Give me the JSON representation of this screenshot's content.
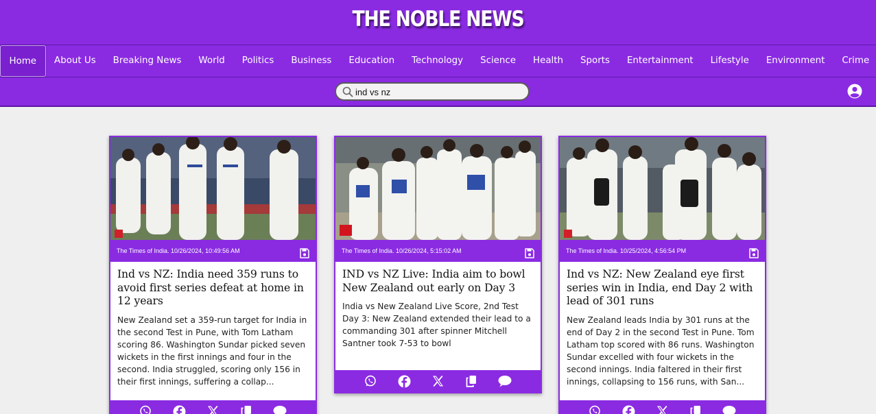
{
  "site": {
    "title": "THE NOBLE NEWS"
  },
  "nav": {
    "items": [
      {
        "label": "Home",
        "active": true
      },
      {
        "label": "About Us"
      },
      {
        "label": "Breaking News"
      },
      {
        "label": "World"
      },
      {
        "label": "Politics"
      },
      {
        "label": "Business"
      },
      {
        "label": "Education"
      },
      {
        "label": "Technology"
      },
      {
        "label": "Science"
      },
      {
        "label": "Health"
      },
      {
        "label": "Sports"
      },
      {
        "label": "Entertainment"
      },
      {
        "label": "Lifestyle"
      },
      {
        "label": "Environment"
      },
      {
        "label": "Crime"
      }
    ]
  },
  "search": {
    "value": "ind vs nz",
    "icon": "search-icon"
  },
  "user": {
    "icon": "user-circle-icon"
  },
  "colors": {
    "brand": "#8a2be2",
    "background": "#efefef"
  },
  "articles": [
    {
      "meta": "The Times of India. 10/26/2024, 10:49:56 AM",
      "title": "Ind vs NZ: India need 359 runs to avoid first series defeat at home in 12 years",
      "description": "New Zealand set a 359-run target for India in the second Test in Pune, with Tom Latham scoring 86. Washington Sundar picked seven wickets in the first innings and four in the second. India struggled, scoring only 156 in their first innings, suffering a collap..."
    },
    {
      "meta": "The Times of India. 10/26/2024, 5:15:02 AM",
      "title": "IND vs NZ Live: India aim to bowl New Zealand out early on Day 3",
      "description": "India vs New Zealand Live Score, 2nd Test Day 3: New Zealand extended their lead to a commanding 301 after spinner Mitchell Santner took 7-53 to bowl"
    },
    {
      "meta": "The Times of India. 10/25/2024, 4:56:54 PM",
      "title": "Ind vs NZ: New Zealand eye first series win in India, end Day 2 with lead of 301 runs",
      "description": "New Zealand leads India by 301 runs at the end of Day 2 in the second Test in Pune. Tom Latham top scored with 86 runs. Washington Sundar excelled with four wickets in the second innings. India faltered in their first innings, collapsing to 156 runs, with San..."
    }
  ],
  "share_icons": [
    "whatsapp-icon",
    "facebook-icon",
    "x-icon",
    "copy-icon",
    "comment-icon"
  ]
}
